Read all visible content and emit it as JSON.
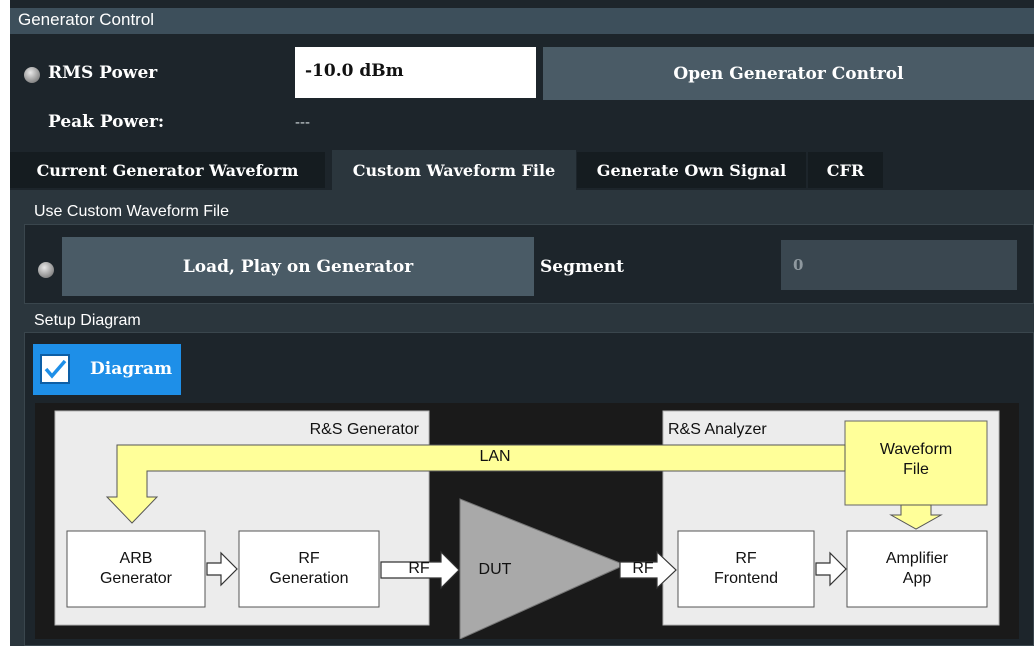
{
  "generator_control": {
    "title": "Generator Control",
    "rms_power_label": "RMS Power",
    "rms_power_value": "-10.0 dBm",
    "open_generator_label": "Open Generator Control",
    "peak_power_label": "Peak Power:",
    "peak_power_value": "---"
  },
  "tabs": [
    {
      "label": "Current Generator Waveform",
      "active": false
    },
    {
      "label": "Custom Waveform File",
      "active": true
    },
    {
      "label": "Generate Own Signal",
      "active": false
    },
    {
      "label": "CFR",
      "active": false
    }
  ],
  "custom_waveform": {
    "section_title": "Use Custom Waveform File",
    "load_play_label": "Load, Play on Generator",
    "segment_label": "Segment",
    "segment_value": "0"
  },
  "setup_diagram": {
    "section_title": "Setup Diagram",
    "diagram_toggle_label": "Diagram",
    "diagram_checked": true,
    "labels": {
      "generator_title": "R&S Generator",
      "analyzer_title": "R&S Analyzer",
      "lan": "LAN",
      "waveform_file_1": "Waveform",
      "waveform_file_2": "File",
      "arb_1": "ARB",
      "arb_2": "Generator",
      "rf_gen_1": "RF",
      "rf_gen_2": "Generation",
      "rf_out": "RF",
      "dut": "DUT",
      "rf_in": "RF",
      "rf_front_1": "RF",
      "rf_front_2": "Frontend",
      "amp_1": "Amplifier",
      "amp_2": "App"
    }
  },
  "colors": {
    "dialog_bg": "#1d252b",
    "button_bg": "#4a5b66",
    "checkbox_accent": "#1e8fe8",
    "lan_bar": "#ffff99",
    "dut_triangle": "#a9a9a9"
  }
}
